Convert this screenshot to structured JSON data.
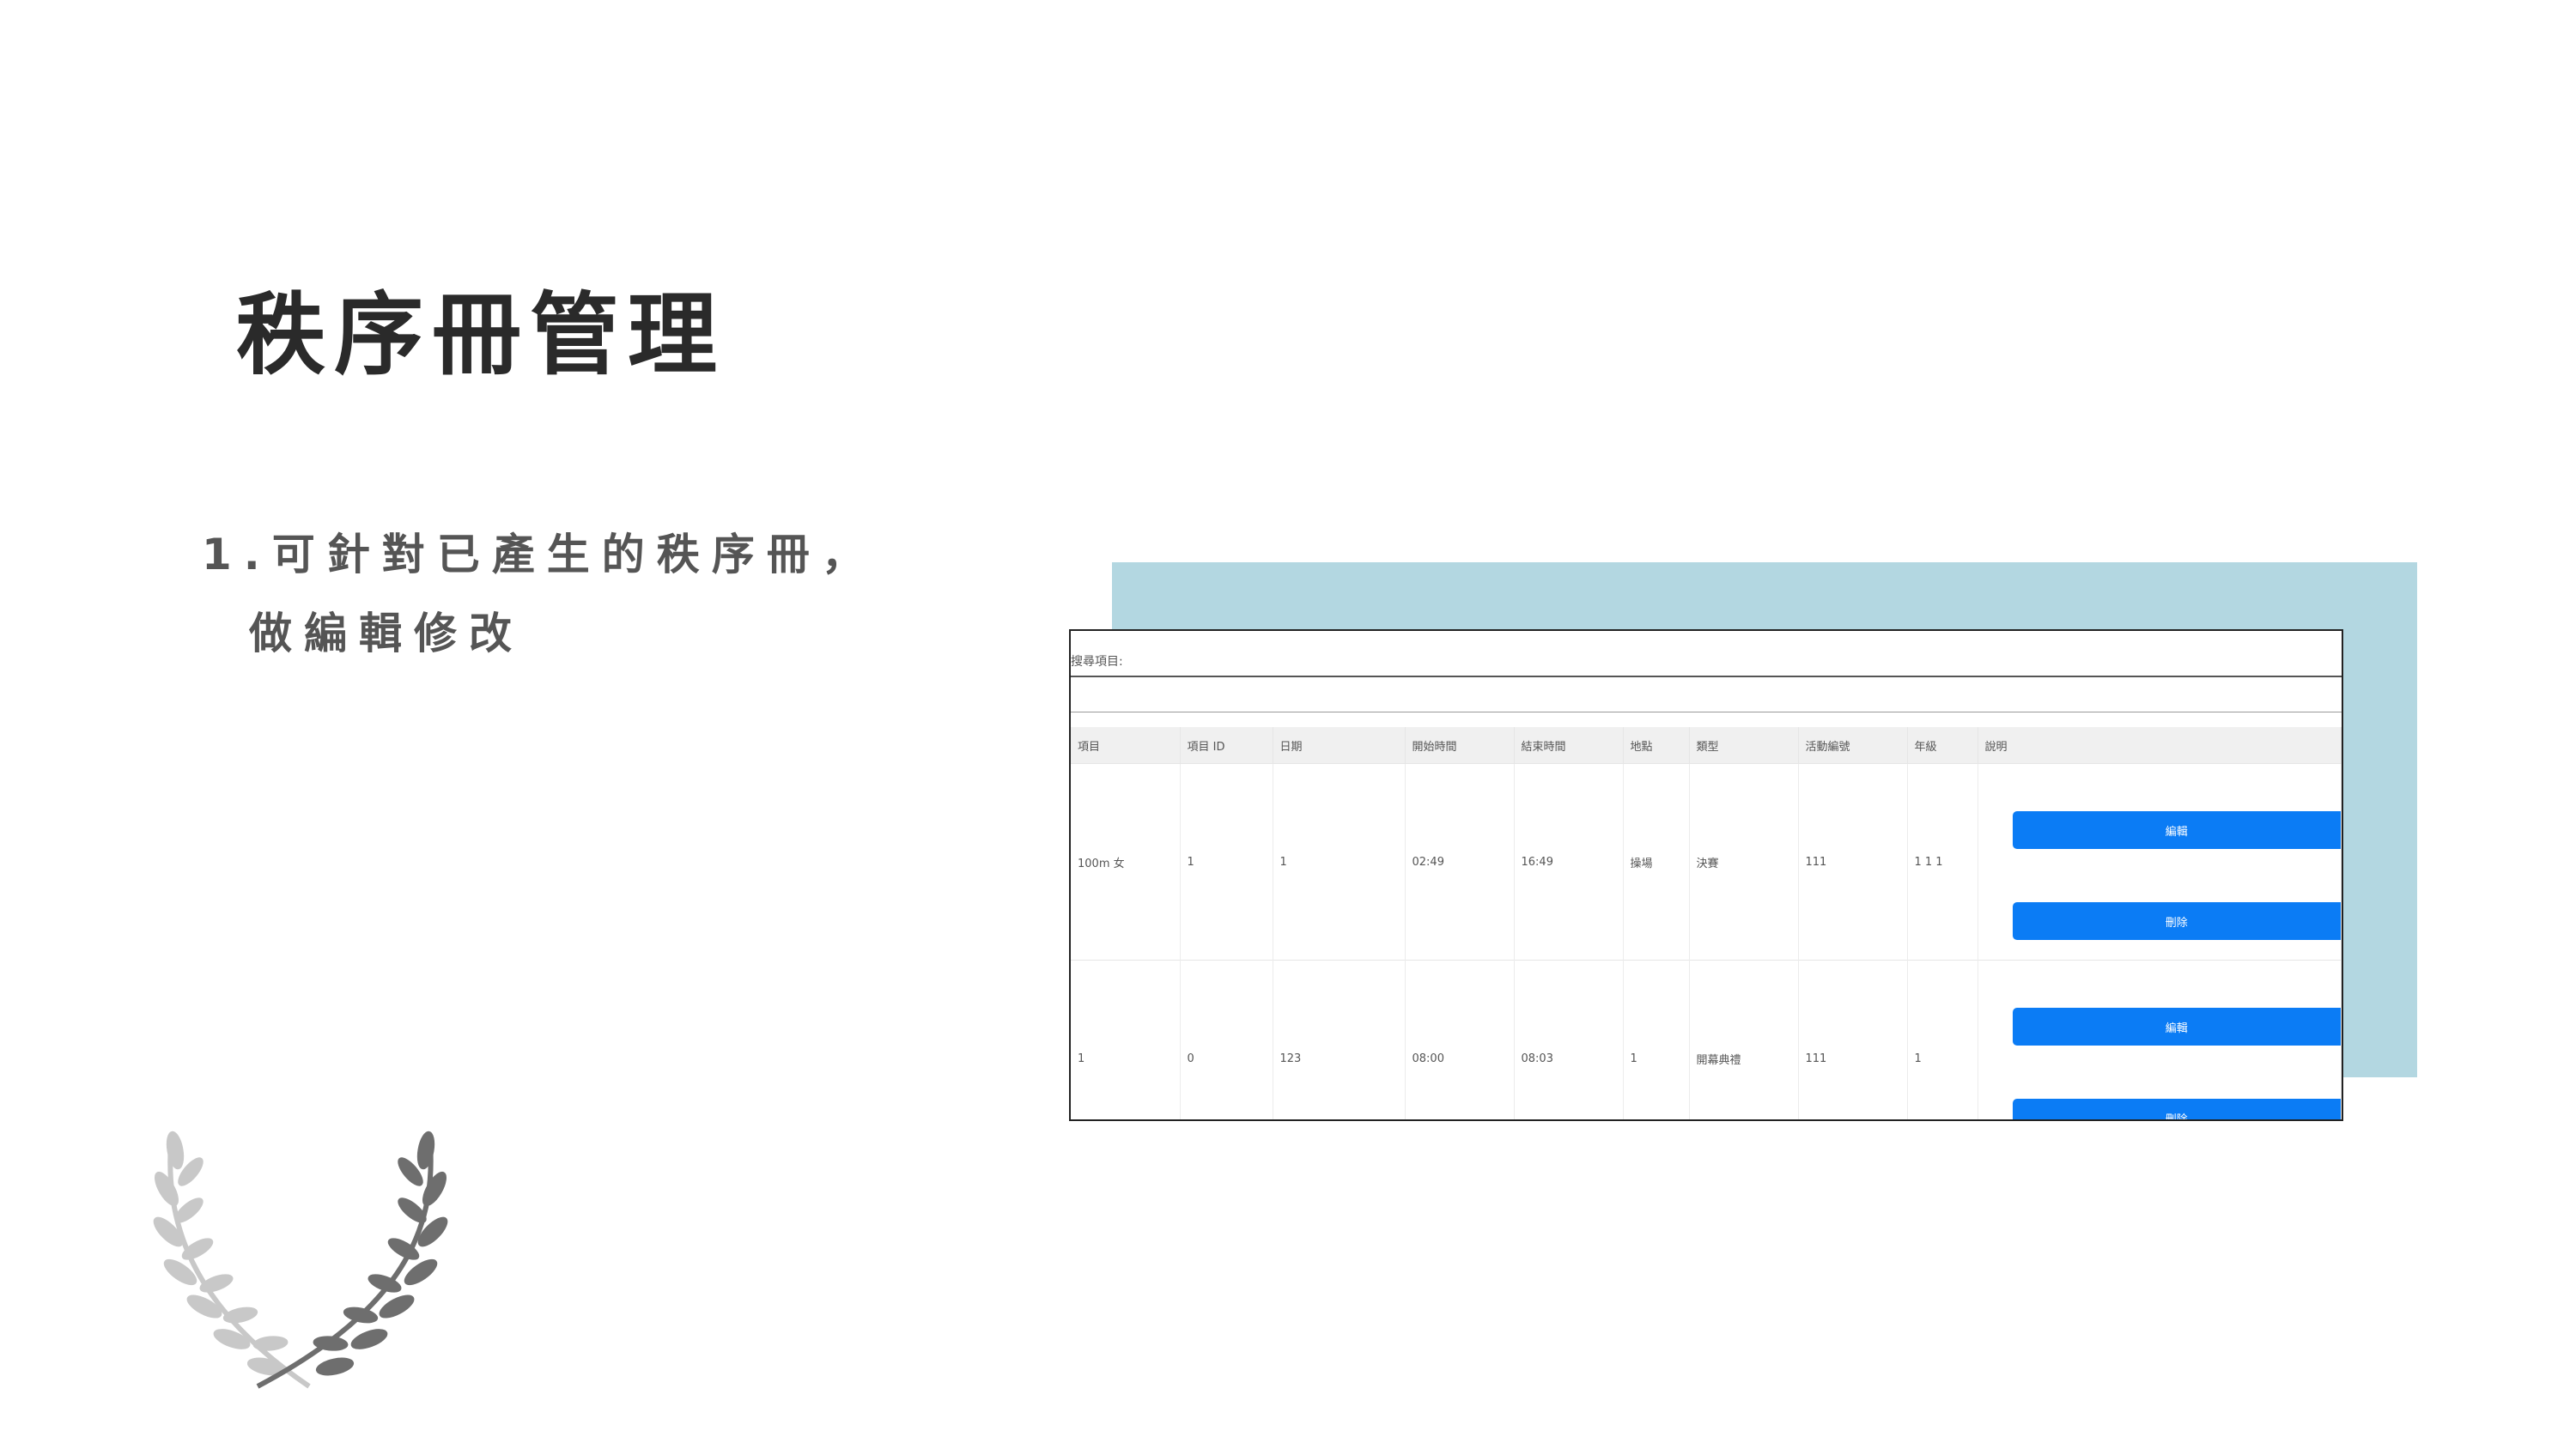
{
  "slide": {
    "title": "秩序冊管理",
    "bullet_line1": "1.可針對已產生的秩序冊，",
    "bullet_line2": "做編輯修改"
  },
  "app": {
    "search_label": "搜尋項目:",
    "columns": [
      "項目",
      "項目 ID",
      "日期",
      "開始時間",
      "結束時間",
      "地點",
      "類型",
      "活動編號",
      "年級",
      "說明"
    ],
    "rows": [
      {
        "item": "100m 女",
        "item_id": "1",
        "date": "1",
        "start": "02:49",
        "end": "16:49",
        "place": "操場",
        "type": "決賽",
        "activity_no": "111",
        "grade": "1 1 1",
        "edit_label": "編輯",
        "delete_label": "刪除"
      },
      {
        "item": "1",
        "item_id": "0",
        "date": "123",
        "start": "08:00",
        "end": "08:03",
        "place": "1",
        "type": "開幕典禮",
        "activity_no": "111",
        "grade": "1",
        "edit_label": "編輯",
        "delete_label": "刪除"
      }
    ]
  },
  "colors": {
    "accent_backdrop": "#b3d7e1",
    "button_primary": "#0b7cf5",
    "laurel_left": "#c8c8c8",
    "laurel_right": "#6e6e6e"
  }
}
